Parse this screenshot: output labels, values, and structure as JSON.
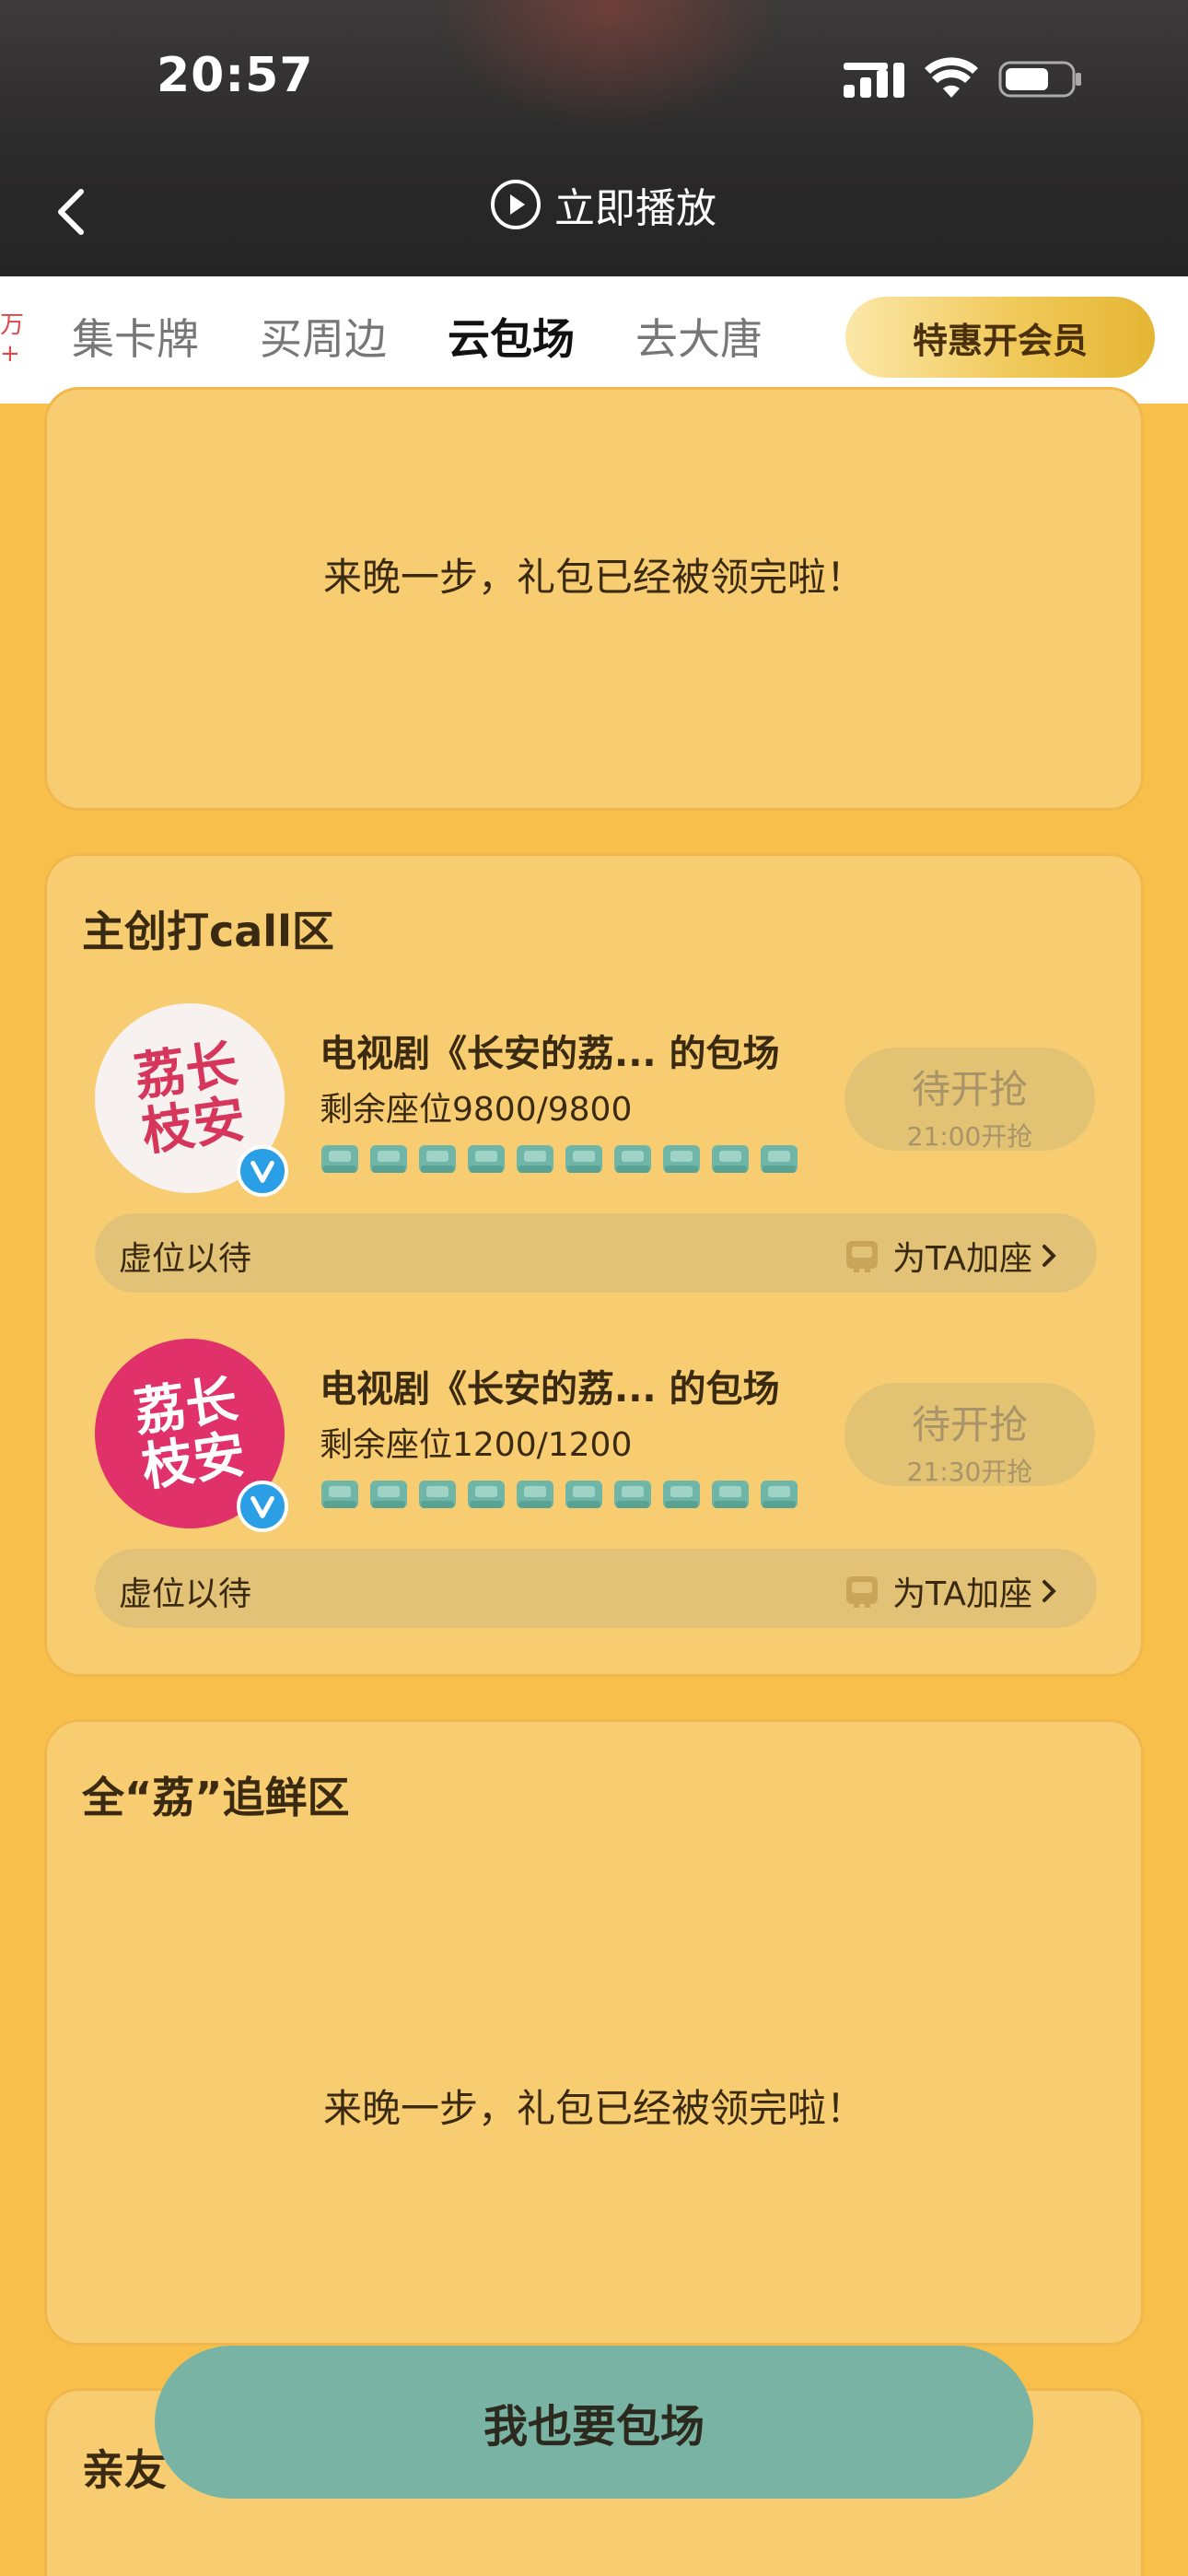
{
  "status_bar": {
    "time": "20:57"
  },
  "header": {
    "play_label": "立即播放"
  },
  "tabs": {
    "new_tag": "万+",
    "items": [
      {
        "label": "集卡牌",
        "active": false
      },
      {
        "label": "买周边",
        "active": false
      },
      {
        "label": "云包场",
        "active": true
      },
      {
        "label": "去大唐",
        "active": false
      }
    ],
    "vip_button": "特惠开会员"
  },
  "sections": {
    "top_gift": {
      "message": "来晚一步，礼包已经被领完啦！"
    },
    "creator_zone": {
      "title": "主创打call区",
      "entries": [
        {
          "name": "电视剧《长安的荔... 的包场",
          "seats": "剩余座位9800/9800",
          "status": "待开抢",
          "time": "21:00开抢",
          "bar_left": "虚位以待",
          "bar_right": "为TA加座",
          "logo_text": "荔长枝安",
          "logo_color": "#d6365b",
          "avatar_bg": "#f7f2ef"
        },
        {
          "name": "电视剧《长安的荔... 的包场",
          "seats": "剩余座位1200/1200",
          "status": "待开抢",
          "time": "21:30开抢",
          "bar_left": "虚位以待",
          "bar_right": "为TA加座",
          "logo_text": "荔长枝安",
          "logo_color": "#ffffff",
          "avatar_bg": "#e0316a"
        }
      ]
    },
    "fresh_zone": {
      "title": "全“荔”追鲜区",
      "message": "来晚一步，礼包已经被领完啦！"
    },
    "friends_zone": {
      "title": "亲友"
    }
  },
  "cta": {
    "label": "我也要包场"
  },
  "colors": {
    "page_bg": "#f8c04a",
    "card_bg": "#f8cd72",
    "seat_icon": "#6fb6a8",
    "cta_bg": "#78b3a4",
    "badge_blue": "#2a9fe6"
  }
}
